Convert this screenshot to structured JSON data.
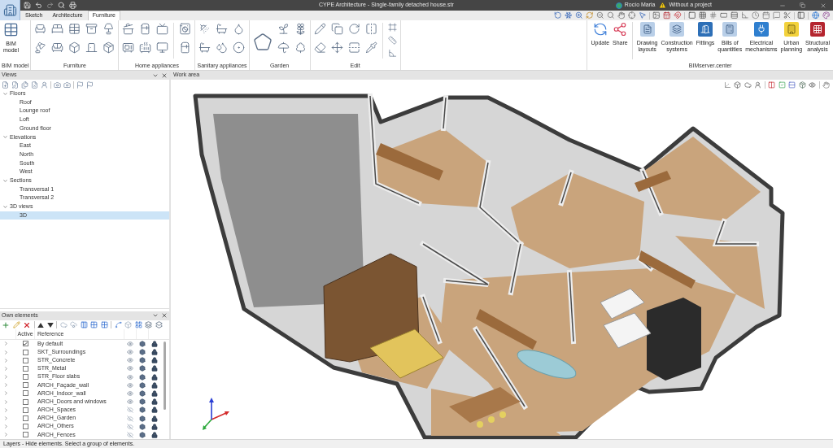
{
  "window": {
    "title": "CYPE Architecture - Single-family detached house.str",
    "user": "Rocío Maria",
    "project": "Without a project"
  },
  "tabs": [
    {
      "label": "Sketch",
      "selected": false
    },
    {
      "label": "Architecture",
      "selected": false
    },
    {
      "label": "Furniture",
      "selected": true
    }
  ],
  "ribbon": {
    "groups": [
      {
        "kind": "buttons",
        "label": "BIM model",
        "buttons": [
          {
            "label": "BIM model"
          }
        ]
      },
      {
        "kind": "icons",
        "label": "Furniture"
      },
      {
        "kind": "icons",
        "label": "Home appliances"
      },
      {
        "kind": "icons",
        "label": "Sanitary appliances"
      },
      {
        "kind": "icons",
        "label": "Garden"
      },
      {
        "kind": "icons",
        "label": "Edit"
      },
      {
        "kind": "buttons",
        "label": "BIMserver.center",
        "buttons": [
          {
            "label": "Update"
          },
          {
            "label": "Share"
          },
          {
            "label": "Drawing layouts"
          },
          {
            "label": "Construction systems"
          },
          {
            "label": "Fittings"
          },
          {
            "label": "Bills of quantities"
          },
          {
            "label": "Electrical mechanisms"
          },
          {
            "label": "Urban planning"
          },
          {
            "label": "Structural analysis"
          }
        ]
      }
    ]
  },
  "views": {
    "title": "Views",
    "tree": [
      {
        "label": "Floors",
        "expanded": true,
        "selected": false,
        "children": [
          {
            "label": "Roof",
            "selected": false
          },
          {
            "label": "Lounge roof",
            "selected": false
          },
          {
            "label": "Loft",
            "selected": false
          },
          {
            "label": "Ground floor",
            "selected": false
          }
        ]
      },
      {
        "label": "Elevations",
        "expanded": true,
        "selected": false,
        "children": [
          {
            "label": "East",
            "selected": false
          },
          {
            "label": "North",
            "selected": false
          },
          {
            "label": "South",
            "selected": false
          },
          {
            "label": "West",
            "selected": false
          }
        ]
      },
      {
        "label": "Sections",
        "expanded": true,
        "selected": false,
        "children": [
          {
            "label": "Transversal 1",
            "selected": false
          },
          {
            "label": "Transversal 2",
            "selected": false
          }
        ]
      },
      {
        "label": "3D views",
        "expanded": true,
        "selected": false,
        "children": [
          {
            "label": "3D",
            "selected": true
          }
        ]
      }
    ]
  },
  "work_area": {
    "title": "Work area"
  },
  "own_elements": {
    "title": "Own elements",
    "columns": [
      "Active",
      "Reference"
    ],
    "rows": [
      {
        "reference": "By default",
        "active": true,
        "visible": true,
        "expanded": false
      },
      {
        "reference": "SKT_Surroundings",
        "active": false,
        "visible": true,
        "expanded": false
      },
      {
        "reference": "STR_Concrete",
        "active": false,
        "visible": true,
        "expanded": false
      },
      {
        "reference": "STR_Metal",
        "active": false,
        "visible": true,
        "expanded": false
      },
      {
        "reference": "STR_Floor slabs",
        "active": false,
        "visible": true,
        "expanded": false
      },
      {
        "reference": "ARCH_Façade_wall",
        "active": false,
        "visible": true,
        "expanded": false
      },
      {
        "reference": "ARCH_Indoor_wall",
        "active": false,
        "visible": true,
        "expanded": false
      },
      {
        "reference": "ARCH_Doors and windows",
        "active": false,
        "visible": true,
        "expanded": false
      },
      {
        "reference": "ARCH_Spaces",
        "active": false,
        "visible": false,
        "expanded": false
      },
      {
        "reference": "ARCH_Garden",
        "active": false,
        "visible": false,
        "expanded": false
      },
      {
        "reference": "ARCH_Others",
        "active": false,
        "visible": false,
        "expanded": false
      },
      {
        "reference": "ARCH_Fences",
        "active": false,
        "visible": false,
        "expanded": false
      }
    ]
  },
  "status_bar": "Layers - Hide elements. Select a group of elements."
}
